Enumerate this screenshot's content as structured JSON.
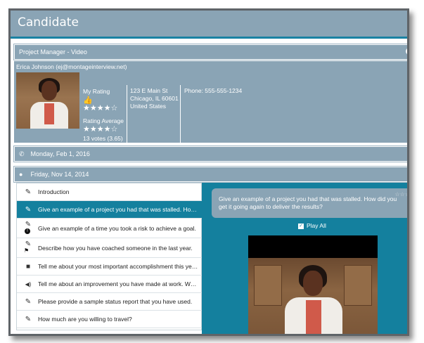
{
  "window": {
    "title": "Candidate"
  },
  "sections": {
    "project": "Project Manager - Video",
    "phone_date": "Monday, Feb 1, 2016",
    "chat_date": "Friday, Nov 14, 2014"
  },
  "candidate": {
    "name_email": "Erica Johnson (ej@montageinterview.net)",
    "my_rating_label": "My Rating",
    "my_rating": 4,
    "my_rating_stars": "★★★★☆",
    "rating_average_label": "Rating Average",
    "rating_average": 3.65,
    "rating_average_stars": "★★★★☆",
    "votes": "13 votes (3.65)",
    "address": {
      "line1": "123 E Main St",
      "line2": "Chicago, IL 60601",
      "line3": "United States"
    },
    "phone": "Phone: 555-555-1234"
  },
  "questions": [
    {
      "text": "Introduction",
      "icon": "edit-icon",
      "active": false
    },
    {
      "text": "Give an example of a project you had that was stalled. How did you get it going again to deliver the results?",
      "icon": "edit-icon",
      "active": true
    },
    {
      "text": "Give an example of a time you took a risk to achieve a goal.",
      "icon": "edit-icon",
      "active": false
    },
    {
      "text": "Describe how you have coached someone in the last year.",
      "icon": "edit-icon",
      "active": false
    },
    {
      "text": "Tell me about your most important accomplishment this year.",
      "icon": "video-camera-icon",
      "active": false
    },
    {
      "text": "Tell me about an improvement you have made at work. What was the result?",
      "icon": "speaker-icon",
      "active": false
    },
    {
      "text": "Please provide a sample status report that you have used.",
      "icon": "edit-icon",
      "active": false
    },
    {
      "text": "How much are you willing to travel?",
      "icon": "edit-icon",
      "active": false
    }
  ],
  "question_panel": {
    "bubble_text": "Give an example of a project you had that was stalled. How did you get it going again to deliver the results?",
    "bubble_stars": "☆☆☆",
    "play_all_label": "Play All",
    "play_all_checked": true
  },
  "icons": {
    "edit": "✎",
    "camera": "■",
    "speaker": "◀)",
    "phone": "✆",
    "chat": "●",
    "thumb": "👍",
    "check": "✓",
    "info": "!",
    "flag": "⚑"
  },
  "colors": {
    "header": "#8aa4b5",
    "accent": "#14809e",
    "border": "#1a82a3"
  }
}
